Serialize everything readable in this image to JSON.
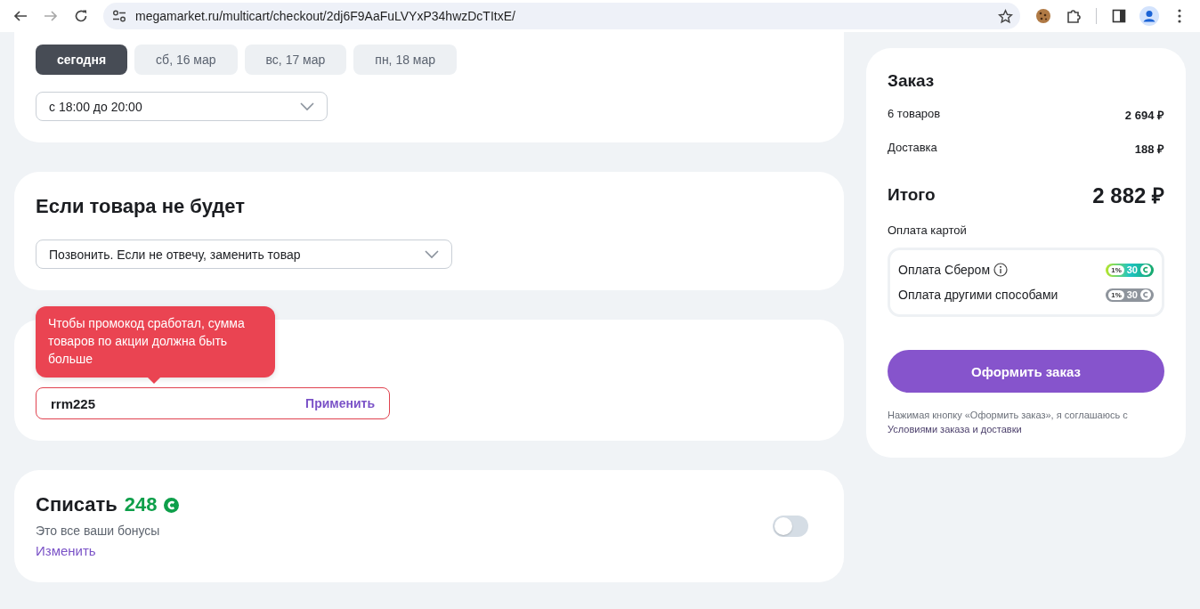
{
  "browser": {
    "url": "megamarket.ru/multicart/checkout/2dj6F9AaFuLVYxP34hwzDcTItxE/"
  },
  "delivery": {
    "days": [
      {
        "label": "сегодня",
        "selected": true
      },
      {
        "label": "сб, 16 мар",
        "selected": false
      },
      {
        "label": "вс, 17 мар",
        "selected": false
      },
      {
        "label": "пн, 18 мар",
        "selected": false
      }
    ],
    "time_slot": {
      "value": "с 18:00 до 20:00"
    }
  },
  "if_missing": {
    "title": "Если товара не будет",
    "option": {
      "value": "Позвонить. Если не отвечу, заменить товар"
    }
  },
  "promo": {
    "tooltip": "Чтобы промокод сработал, сумма товаров по акции должна быть больше",
    "code": "rrm225",
    "error": true,
    "apply_label": "Применить"
  },
  "bonuses": {
    "title": "Списать",
    "amount": "248",
    "note": "Это все ваши бонусы",
    "change_link": "Изменить",
    "toggle_on": false
  },
  "order": {
    "title": "Заказ",
    "lines": [
      {
        "label": "6 товаров",
        "value": "2 694 ₽"
      },
      {
        "label": "Доставка",
        "value": "188 ₽"
      }
    ],
    "total_label": "Итого",
    "total": "2 882 ₽",
    "payment_label": "Оплата картой",
    "payment_options": [
      {
        "kind": "sber",
        "label": "Оплата Сбером",
        "info": true,
        "percent": "1%",
        "cashback": "30"
      },
      {
        "kind": "plain",
        "label": "Оплата другими способами",
        "info": false,
        "percent": "1%",
        "cashback": "30"
      }
    ],
    "submit": "Оформить заказ",
    "terms": "Нажимая кнопку «Оформить заказ», я соглашаюсь с",
    "terms_link": "Условиями заказа и доставки"
  }
}
